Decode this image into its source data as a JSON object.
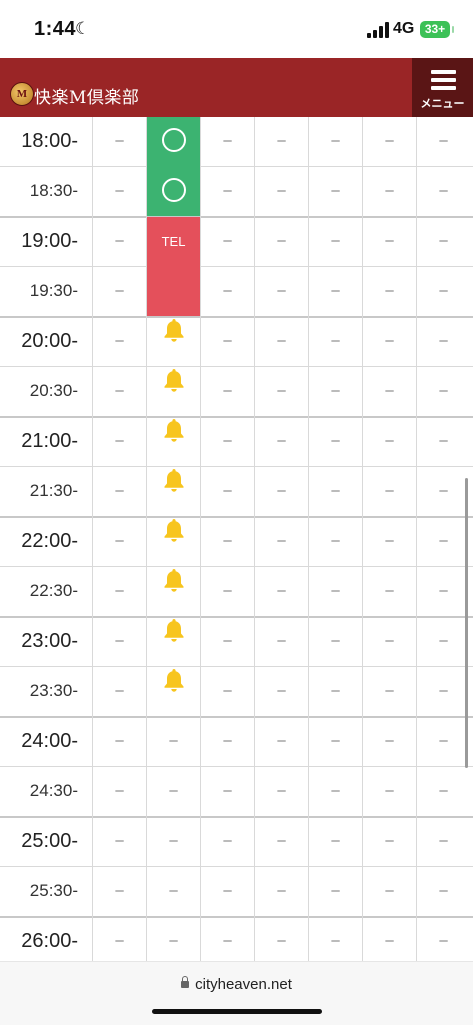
{
  "status_bar": {
    "time": "1:44",
    "network": "4G",
    "battery": "33+"
  },
  "header": {
    "logo_mark": "M",
    "logo_text": "快楽M倶楽部",
    "menu_label": "メニュー"
  },
  "schedule": {
    "empty_mark": "–",
    "tel_label": "TEL",
    "rows": [
      {
        "time": "18:00-",
        "hour": true,
        "c2": "ok"
      },
      {
        "time": "18:30-",
        "hour": false,
        "c2": "ok"
      },
      {
        "time": "19:00-",
        "hour": true,
        "c2": "tel"
      },
      {
        "time": "19:30-",
        "hour": false,
        "c2": "tel"
      },
      {
        "time": "20:00-",
        "hour": true,
        "c2": "bell"
      },
      {
        "time": "20:30-",
        "hour": false,
        "c2": "bell"
      },
      {
        "time": "21:00-",
        "hour": true,
        "c2": "bell"
      },
      {
        "time": "21:30-",
        "hour": false,
        "c2": "bell"
      },
      {
        "time": "22:00-",
        "hour": true,
        "c2": "bell"
      },
      {
        "time": "22:30-",
        "hour": false,
        "c2": "bell"
      },
      {
        "time": "23:00-",
        "hour": true,
        "c2": "bell"
      },
      {
        "time": "23:30-",
        "hour": false,
        "c2": "bell"
      },
      {
        "time": "24:00-",
        "hour": true,
        "c2": "dash"
      },
      {
        "time": "24:30-",
        "hour": false,
        "c2": "dash"
      },
      {
        "time": "25:00-",
        "hour": true,
        "c2": "dash"
      },
      {
        "time": "25:30-",
        "hour": false,
        "c2": "dash"
      },
      {
        "time": "26:00-",
        "hour": true,
        "c2": "dash"
      }
    ]
  },
  "browser": {
    "url": "cityheaven.net"
  },
  "colors": {
    "header": "#9a2526",
    "available": "#3cb371",
    "tel": "#e4505b",
    "bell": "#f7c51e"
  }
}
